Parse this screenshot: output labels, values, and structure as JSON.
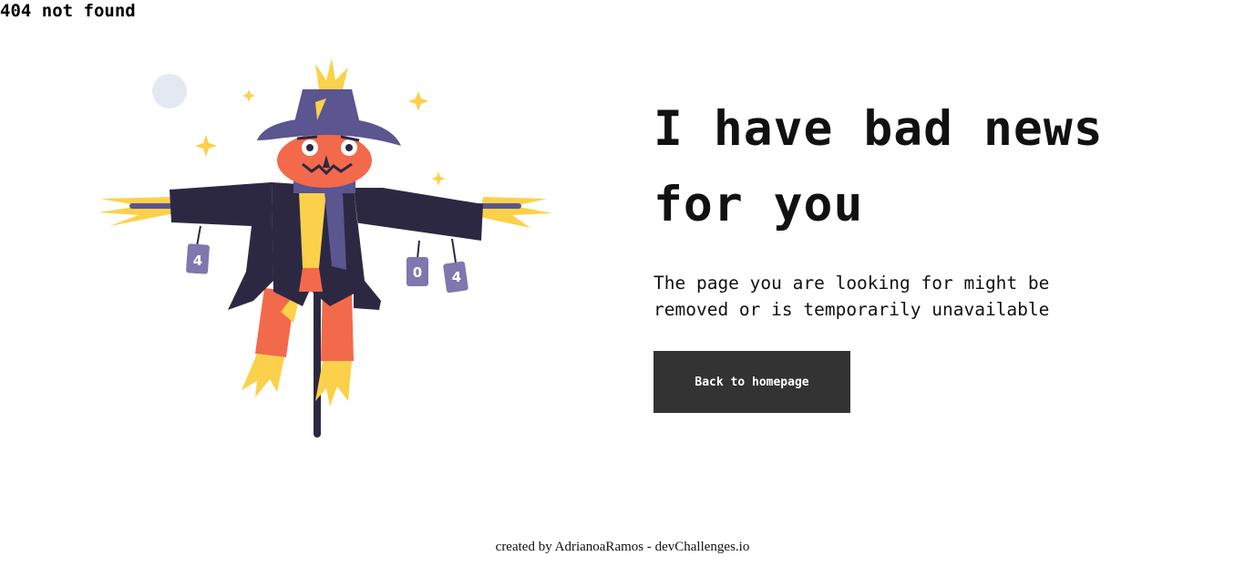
{
  "page": {
    "title": "404 not found"
  },
  "illustration": {
    "icon": "scarecrow-illustration",
    "can_labels": [
      "4",
      "0",
      "4"
    ],
    "colors": {
      "hat": "#5b5590",
      "coat": "#2d2842",
      "face": "#f26a4b",
      "straw": "#fbd14b",
      "scarf": "#5b5590",
      "moon": "#e4e8f3"
    }
  },
  "main": {
    "headline": "I have bad news for you",
    "message": "The page you are looking for might be removed or is temporarily unavailable",
    "button_label": "Back to homepage"
  },
  "footer": {
    "credit": "created by AdrianoaRamos - devChallenges.io"
  },
  "colors": {
    "button_bg": "#333333",
    "button_text": "#ffffff",
    "text": "#111111",
    "background": "#ffffff"
  }
}
